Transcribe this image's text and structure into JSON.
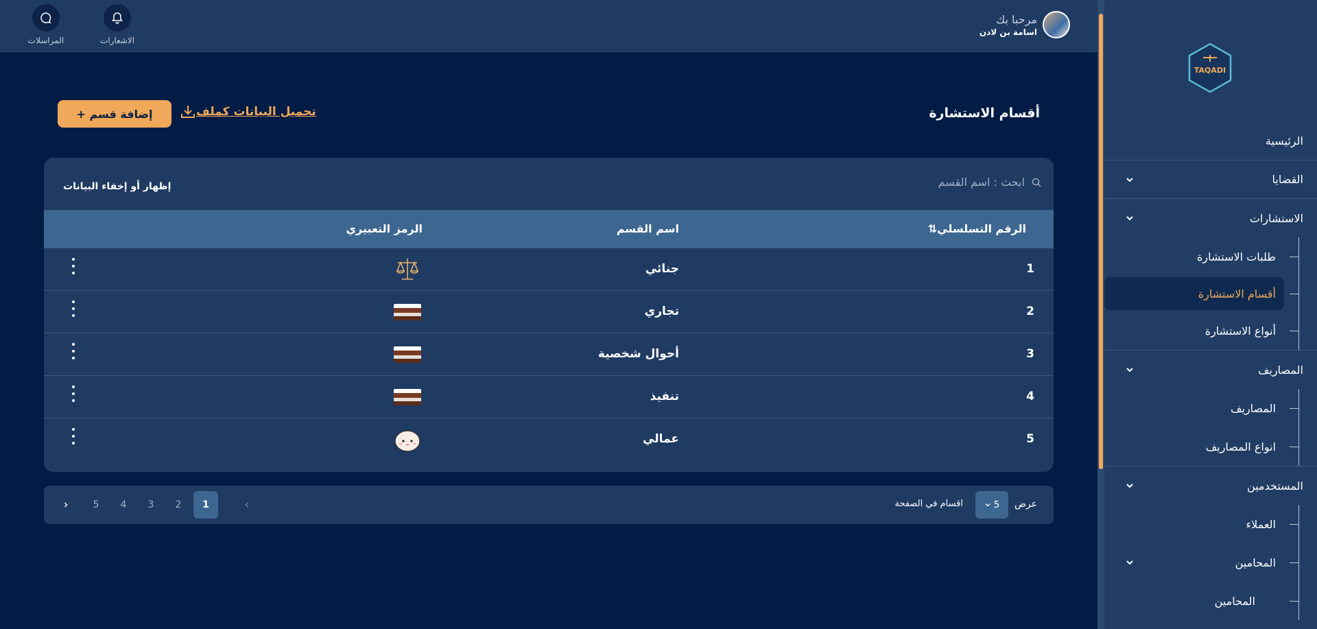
{
  "header": {
    "notifications_label": "الاشعارات",
    "messages_label": "المراسلات",
    "greeting": "مرحبا بك",
    "user_name": "اسامة بن لادن"
  },
  "sidebar": {
    "logo_text": "TAQADI",
    "items": [
      {
        "label": "الرئيسية"
      },
      {
        "label": "القضايا"
      },
      {
        "label": "الاستشارات"
      },
      {
        "label": "طلبات الاستشارة"
      },
      {
        "label": "أقسام الاستشارة"
      },
      {
        "label": "أنواع الاستشارة"
      },
      {
        "label": "المصاريف"
      },
      {
        "label": "المصاريف"
      },
      {
        "label": "انواع المصاريف"
      },
      {
        "label": "المستخدمين"
      },
      {
        "label": "العملاء"
      },
      {
        "label": "المحامين"
      },
      {
        "label": "المحامين"
      }
    ],
    "accent": "#f0a85a"
  },
  "page": {
    "title": "أقسام الاستشارة",
    "add_button": "إضافة قسم +",
    "download_label": "تحميل البيانات كملف"
  },
  "table": {
    "search_placeholder": "ابحث : اسم القسم",
    "toggle_columns": "إظهار أو إخفاء البيانات",
    "columns": [
      "الرقم التسلسلي⇅",
      "اسم القسم",
      "الرمز التعبيري"
    ],
    "rows": [
      {
        "id": "1",
        "name": "جنائي",
        "icon": "scales-icon"
      },
      {
        "id": "2",
        "name": "تجاري",
        "icon": "photo-thumbnail"
      },
      {
        "id": "3",
        "name": "أحوال شخصية",
        "icon": "photo-thumbnail"
      },
      {
        "id": "4",
        "name": "تنفيذ",
        "icon": "photo-thumbnail"
      },
      {
        "id": "5",
        "name": "عمالي",
        "icon": "dumpling-emoji"
      }
    ]
  },
  "pagination": {
    "show_label": "عرض",
    "per_page_value": "5",
    "per_page_label": "اقسام في الصفحة",
    "pages": [
      "1",
      "2",
      "3",
      "4",
      "5"
    ],
    "current_page": "1"
  }
}
